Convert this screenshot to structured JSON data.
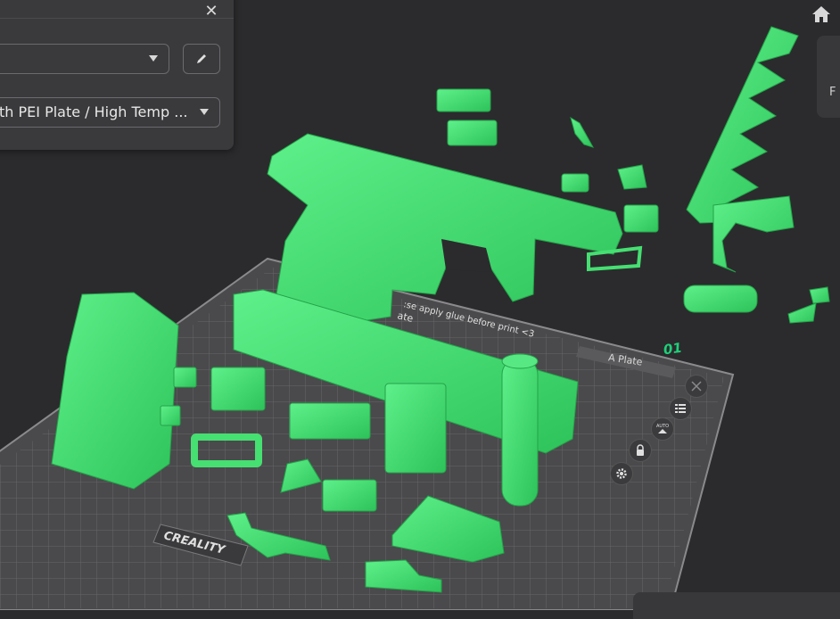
{
  "panel": {
    "close_glyph": "✕",
    "printer_dropdown": {
      "value": ""
    },
    "plate_dropdown": {
      "value": "th PEI Plate / High Temp ..."
    }
  },
  "side_tab": {
    "label": "F"
  },
  "plate": {
    "number": "01",
    "name": "A Plate",
    "brand": "CREALITY",
    "note": ":se apply glue before print <3",
    "label": "ate",
    "auto_label": "AUTO"
  },
  "icons": {
    "home": "home-icon",
    "edit": "pencil-icon",
    "close": "close-icon",
    "plate_close": "close-circle-icon",
    "arrange": "list-icon",
    "auto_orient": "auto-orient-icon",
    "lock": "lock-icon",
    "settings": "gear-icon"
  },
  "colors": {
    "background": "#2b2b2d",
    "panel": "#3a3a3c",
    "model": "#3ddc6a",
    "accent": "#1fd07a"
  }
}
